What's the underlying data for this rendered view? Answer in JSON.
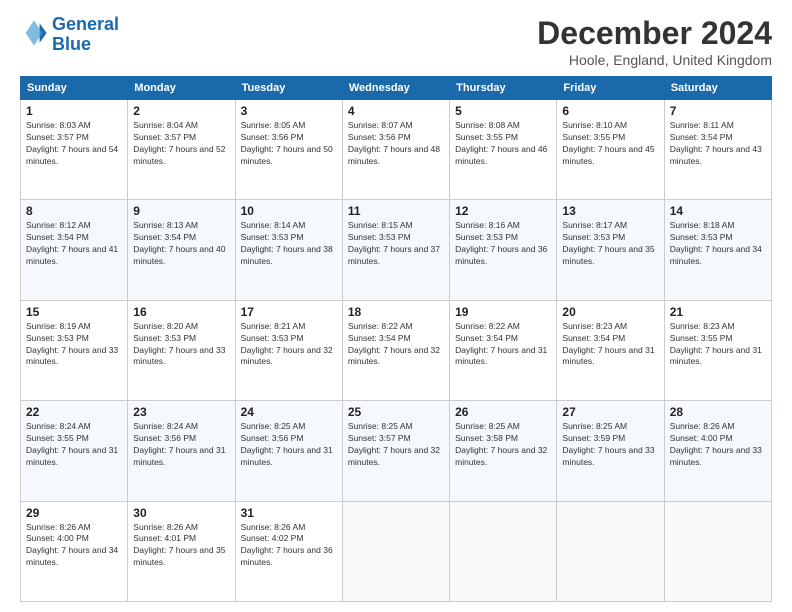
{
  "header": {
    "logo_line1": "General",
    "logo_line2": "Blue",
    "month": "December 2024",
    "location": "Hoole, England, United Kingdom"
  },
  "weekdays": [
    "Sunday",
    "Monday",
    "Tuesday",
    "Wednesday",
    "Thursday",
    "Friday",
    "Saturday"
  ],
  "weeks": [
    [
      {
        "day": "1",
        "sunrise": "Sunrise: 8:03 AM",
        "sunset": "Sunset: 3:57 PM",
        "daylight": "Daylight: 7 hours and 54 minutes."
      },
      {
        "day": "2",
        "sunrise": "Sunrise: 8:04 AM",
        "sunset": "Sunset: 3:57 PM",
        "daylight": "Daylight: 7 hours and 52 minutes."
      },
      {
        "day": "3",
        "sunrise": "Sunrise: 8:05 AM",
        "sunset": "Sunset: 3:56 PM",
        "daylight": "Daylight: 7 hours and 50 minutes."
      },
      {
        "day": "4",
        "sunrise": "Sunrise: 8:07 AM",
        "sunset": "Sunset: 3:56 PM",
        "daylight": "Daylight: 7 hours and 48 minutes."
      },
      {
        "day": "5",
        "sunrise": "Sunrise: 8:08 AM",
        "sunset": "Sunset: 3:55 PM",
        "daylight": "Daylight: 7 hours and 46 minutes."
      },
      {
        "day": "6",
        "sunrise": "Sunrise: 8:10 AM",
        "sunset": "Sunset: 3:55 PM",
        "daylight": "Daylight: 7 hours and 45 minutes."
      },
      {
        "day": "7",
        "sunrise": "Sunrise: 8:11 AM",
        "sunset": "Sunset: 3:54 PM",
        "daylight": "Daylight: 7 hours and 43 minutes."
      }
    ],
    [
      {
        "day": "8",
        "sunrise": "Sunrise: 8:12 AM",
        "sunset": "Sunset: 3:54 PM",
        "daylight": "Daylight: 7 hours and 41 minutes."
      },
      {
        "day": "9",
        "sunrise": "Sunrise: 8:13 AM",
        "sunset": "Sunset: 3:54 PM",
        "daylight": "Daylight: 7 hours and 40 minutes."
      },
      {
        "day": "10",
        "sunrise": "Sunrise: 8:14 AM",
        "sunset": "Sunset: 3:53 PM",
        "daylight": "Daylight: 7 hours and 38 minutes."
      },
      {
        "day": "11",
        "sunrise": "Sunrise: 8:15 AM",
        "sunset": "Sunset: 3:53 PM",
        "daylight": "Daylight: 7 hours and 37 minutes."
      },
      {
        "day": "12",
        "sunrise": "Sunrise: 8:16 AM",
        "sunset": "Sunset: 3:53 PM",
        "daylight": "Daylight: 7 hours and 36 minutes."
      },
      {
        "day": "13",
        "sunrise": "Sunrise: 8:17 AM",
        "sunset": "Sunset: 3:53 PM",
        "daylight": "Daylight: 7 hours and 35 minutes."
      },
      {
        "day": "14",
        "sunrise": "Sunrise: 8:18 AM",
        "sunset": "Sunset: 3:53 PM",
        "daylight": "Daylight: 7 hours and 34 minutes."
      }
    ],
    [
      {
        "day": "15",
        "sunrise": "Sunrise: 8:19 AM",
        "sunset": "Sunset: 3:53 PM",
        "daylight": "Daylight: 7 hours and 33 minutes."
      },
      {
        "day": "16",
        "sunrise": "Sunrise: 8:20 AM",
        "sunset": "Sunset: 3:53 PM",
        "daylight": "Daylight: 7 hours and 33 minutes."
      },
      {
        "day": "17",
        "sunrise": "Sunrise: 8:21 AM",
        "sunset": "Sunset: 3:53 PM",
        "daylight": "Daylight: 7 hours and 32 minutes."
      },
      {
        "day": "18",
        "sunrise": "Sunrise: 8:22 AM",
        "sunset": "Sunset: 3:54 PM",
        "daylight": "Daylight: 7 hours and 32 minutes."
      },
      {
        "day": "19",
        "sunrise": "Sunrise: 8:22 AM",
        "sunset": "Sunset: 3:54 PM",
        "daylight": "Daylight: 7 hours and 31 minutes."
      },
      {
        "day": "20",
        "sunrise": "Sunrise: 8:23 AM",
        "sunset": "Sunset: 3:54 PM",
        "daylight": "Daylight: 7 hours and 31 minutes."
      },
      {
        "day": "21",
        "sunrise": "Sunrise: 8:23 AM",
        "sunset": "Sunset: 3:55 PM",
        "daylight": "Daylight: 7 hours and 31 minutes."
      }
    ],
    [
      {
        "day": "22",
        "sunrise": "Sunrise: 8:24 AM",
        "sunset": "Sunset: 3:55 PM",
        "daylight": "Daylight: 7 hours and 31 minutes."
      },
      {
        "day": "23",
        "sunrise": "Sunrise: 8:24 AM",
        "sunset": "Sunset: 3:56 PM",
        "daylight": "Daylight: 7 hours and 31 minutes."
      },
      {
        "day": "24",
        "sunrise": "Sunrise: 8:25 AM",
        "sunset": "Sunset: 3:56 PM",
        "daylight": "Daylight: 7 hours and 31 minutes."
      },
      {
        "day": "25",
        "sunrise": "Sunrise: 8:25 AM",
        "sunset": "Sunset: 3:57 PM",
        "daylight": "Daylight: 7 hours and 32 minutes."
      },
      {
        "day": "26",
        "sunrise": "Sunrise: 8:25 AM",
        "sunset": "Sunset: 3:58 PM",
        "daylight": "Daylight: 7 hours and 32 minutes."
      },
      {
        "day": "27",
        "sunrise": "Sunrise: 8:25 AM",
        "sunset": "Sunset: 3:59 PM",
        "daylight": "Daylight: 7 hours and 33 minutes."
      },
      {
        "day": "28",
        "sunrise": "Sunrise: 8:26 AM",
        "sunset": "Sunset: 4:00 PM",
        "daylight": "Daylight: 7 hours and 33 minutes."
      }
    ],
    [
      {
        "day": "29",
        "sunrise": "Sunrise: 8:26 AM",
        "sunset": "Sunset: 4:00 PM",
        "daylight": "Daylight: 7 hours and 34 minutes."
      },
      {
        "day": "30",
        "sunrise": "Sunrise: 8:26 AM",
        "sunset": "Sunset: 4:01 PM",
        "daylight": "Daylight: 7 hours and 35 minutes."
      },
      {
        "day": "31",
        "sunrise": "Sunrise: 8:26 AM",
        "sunset": "Sunset: 4:02 PM",
        "daylight": "Daylight: 7 hours and 36 minutes."
      },
      null,
      null,
      null,
      null
    ]
  ]
}
